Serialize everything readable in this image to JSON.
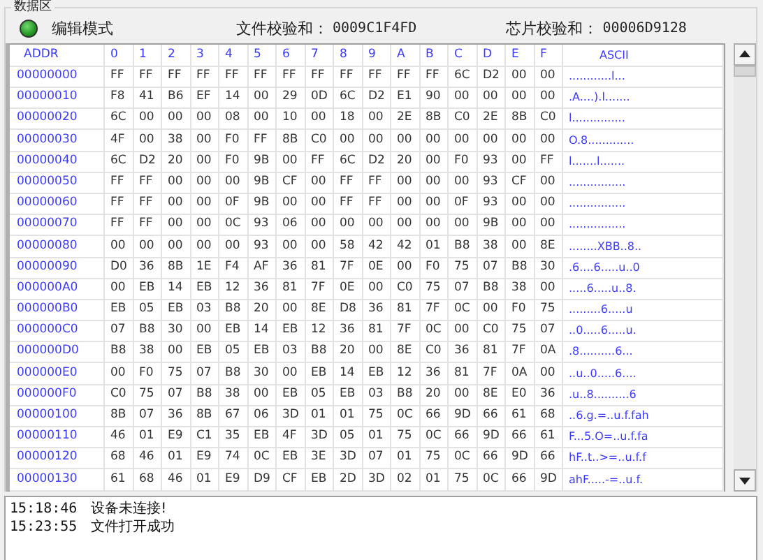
{
  "group_title": "数据区",
  "status": {
    "led_on": true,
    "mode": "编辑模式"
  },
  "file_checksum": {
    "label": "文件校验和：",
    "value": "0009C1F4FD"
  },
  "chip_checksum": {
    "label": "芯片校验和：",
    "value": "00006D9128"
  },
  "table": {
    "columns": [
      "ADDR",
      "0",
      "1",
      "2",
      "3",
      "4",
      "5",
      "6",
      "7",
      "8",
      "9",
      "A",
      "B",
      "C",
      "D",
      "E",
      "F",
      "ASCII"
    ],
    "rows": [
      {
        "addr": "00000000",
        "bytes": [
          "FF",
          "FF",
          "FF",
          "FF",
          "FF",
          "FF",
          "FF",
          "FF",
          "FF",
          "FF",
          "FF",
          "FF",
          "6C",
          "D2",
          "00",
          "00"
        ],
        "ascii": "............l..."
      },
      {
        "addr": "00000010",
        "bytes": [
          "F8",
          "41",
          "B6",
          "EF",
          "14",
          "00",
          "29",
          "0D",
          "6C",
          "D2",
          "E1",
          "90",
          "00",
          "00",
          "00",
          "00"
        ],
        "ascii": ".A....).l......."
      },
      {
        "addr": "00000020",
        "bytes": [
          "6C",
          "00",
          "00",
          "00",
          "08",
          "00",
          "10",
          "00",
          "18",
          "00",
          "2E",
          "8B",
          "C0",
          "2E",
          "8B",
          "C0"
        ],
        "ascii": "l..............."
      },
      {
        "addr": "00000030",
        "bytes": [
          "4F",
          "00",
          "38",
          "00",
          "F0",
          "FF",
          "8B",
          "C0",
          "00",
          "00",
          "00",
          "00",
          "00",
          "00",
          "00",
          "00"
        ],
        "ascii": "O.8............."
      },
      {
        "addr": "00000040",
        "bytes": [
          "6C",
          "D2",
          "20",
          "00",
          "F0",
          "9B",
          "00",
          "FF",
          "6C",
          "D2",
          "20",
          "00",
          "F0",
          "93",
          "00",
          "FF"
        ],
        "ascii": "l.......l......."
      },
      {
        "addr": "00000050",
        "bytes": [
          "FF",
          "FF",
          "00",
          "00",
          "00",
          "9B",
          "CF",
          "00",
          "FF",
          "FF",
          "00",
          "00",
          "00",
          "93",
          "CF",
          "00"
        ],
        "ascii": "................"
      },
      {
        "addr": "00000060",
        "bytes": [
          "FF",
          "FF",
          "00",
          "00",
          "0F",
          "9B",
          "00",
          "00",
          "FF",
          "FF",
          "00",
          "00",
          "0F",
          "93",
          "00",
          "00"
        ],
        "ascii": "................"
      },
      {
        "addr": "00000070",
        "bytes": [
          "FF",
          "FF",
          "00",
          "00",
          "0C",
          "93",
          "06",
          "00",
          "00",
          "00",
          "00",
          "00",
          "00",
          "9B",
          "00",
          "00"
        ],
        "ascii": "................"
      },
      {
        "addr": "00000080",
        "bytes": [
          "00",
          "00",
          "00",
          "00",
          "00",
          "93",
          "00",
          "00",
          "58",
          "42",
          "42",
          "01",
          "B8",
          "38",
          "00",
          "8E"
        ],
        "ascii": "........XBB..8.."
      },
      {
        "addr": "00000090",
        "bytes": [
          "D0",
          "36",
          "8B",
          "1E",
          "F4",
          "AF",
          "36",
          "81",
          "7F",
          "0E",
          "00",
          "F0",
          "75",
          "07",
          "B8",
          "30"
        ],
        "ascii": ".6....6.....u..0"
      },
      {
        "addr": "000000A0",
        "bytes": [
          "00",
          "EB",
          "14",
          "EB",
          "12",
          "36",
          "81",
          "7F",
          "0E",
          "00",
          "C0",
          "75",
          "07",
          "B8",
          "38",
          "00"
        ],
        "ascii": ".....6.....u..8."
      },
      {
        "addr": "000000B0",
        "bytes": [
          "EB",
          "05",
          "EB",
          "03",
          "B8",
          "20",
          "00",
          "8E",
          "D8",
          "36",
          "81",
          "7F",
          "0C",
          "00",
          "F0",
          "75"
        ],
        "ascii": ".........6.....u"
      },
      {
        "addr": "000000C0",
        "bytes": [
          "07",
          "B8",
          "30",
          "00",
          "EB",
          "14",
          "EB",
          "12",
          "36",
          "81",
          "7F",
          "0C",
          "00",
          "C0",
          "75",
          "07"
        ],
        "ascii": "..0.....6.....u."
      },
      {
        "addr": "000000D0",
        "bytes": [
          "B8",
          "38",
          "00",
          "EB",
          "05",
          "EB",
          "03",
          "B8",
          "20",
          "00",
          "8E",
          "C0",
          "36",
          "81",
          "7F",
          "0A"
        ],
        "ascii": ".8..........6..."
      },
      {
        "addr": "000000E0",
        "bytes": [
          "00",
          "F0",
          "75",
          "07",
          "B8",
          "30",
          "00",
          "EB",
          "14",
          "EB",
          "12",
          "36",
          "81",
          "7F",
          "0A",
          "00"
        ],
        "ascii": "..u..0.....6...."
      },
      {
        "addr": "000000F0",
        "bytes": [
          "C0",
          "75",
          "07",
          "B8",
          "38",
          "00",
          "EB",
          "05",
          "EB",
          "03",
          "B8",
          "20",
          "00",
          "8E",
          "E0",
          "36"
        ],
        "ascii": ".u..8..........6"
      },
      {
        "addr": "00000100",
        "bytes": [
          "8B",
          "07",
          "36",
          "8B",
          "67",
          "06",
          "3D",
          "01",
          "01",
          "75",
          "0C",
          "66",
          "9D",
          "66",
          "61",
          "68"
        ],
        "ascii": "..6.g.=..u.f.fah"
      },
      {
        "addr": "00000110",
        "bytes": [
          "46",
          "01",
          "E9",
          "C1",
          "35",
          "EB",
          "4F",
          "3D",
          "05",
          "01",
          "75",
          "0C",
          "66",
          "9D",
          "66",
          "61"
        ],
        "ascii": "F...5.O=..u.f.fa"
      },
      {
        "addr": "00000120",
        "bytes": [
          "68",
          "46",
          "01",
          "E9",
          "74",
          "0C",
          "EB",
          "3E",
          "3D",
          "07",
          "01",
          "75",
          "0C",
          "66",
          "9D",
          "66"
        ],
        "ascii": "hF..t..>=..u.f.f"
      },
      {
        "addr": "00000130",
        "bytes": [
          "61",
          "68",
          "46",
          "01",
          "E9",
          "D9",
          "CF",
          "EB",
          "2D",
          "3D",
          "02",
          "01",
          "75",
          "0C",
          "66",
          "9D"
        ],
        "ascii": "ahF.....-=..u.f."
      }
    ]
  },
  "log": [
    {
      "time": "15:18:46",
      "message": "设备未连接!"
    },
    {
      "time": "15:23:55",
      "message": "文件打开成功"
    }
  ]
}
